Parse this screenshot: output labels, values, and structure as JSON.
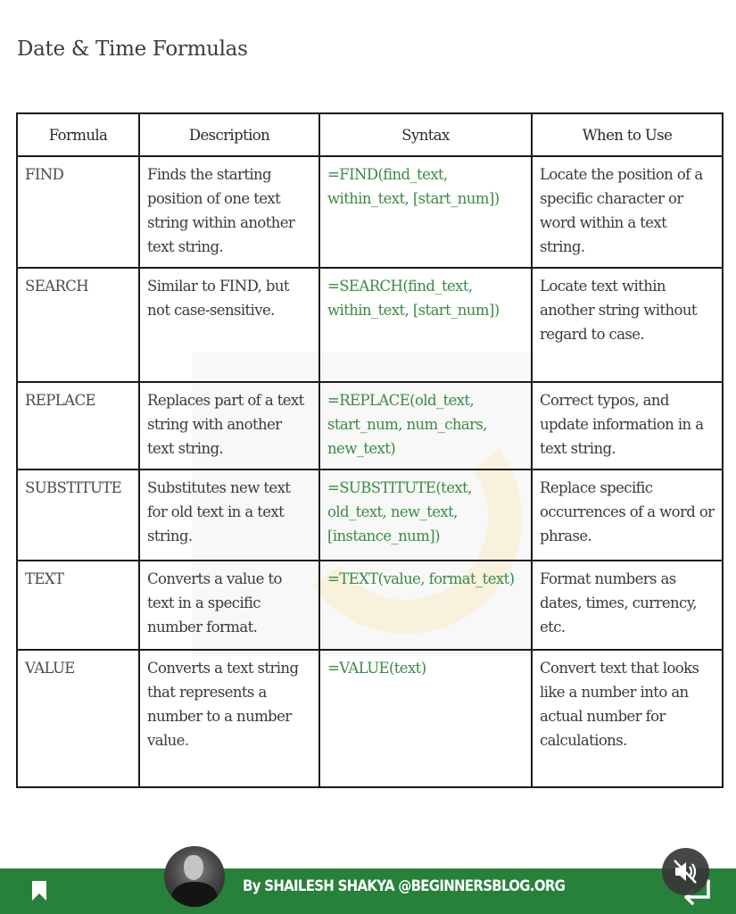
{
  "page": {
    "title": "Date & Time Formulas"
  },
  "table": {
    "headers": [
      "Formula",
      "Description",
      "Syntax",
      "When to Use"
    ],
    "rows": [
      {
        "formula": "FIND",
        "description": "Finds the starting position of one text string within another text string.",
        "syntax": "=FIND(find_text, within_text, [start_num])",
        "when": "Locate the position of a specific character or word within a text string."
      },
      {
        "formula": "SEARCH",
        "description": "Similar to FIND, but not case-sensitive.",
        "syntax": "=SEARCH(find_text, within_text, [start_num])",
        "when": "Locate text within another string without regard to case."
      },
      {
        "formula": "REPLACE",
        "description": "Replaces part of a text string with another text string.",
        "syntax": "=REPLACE(old_text, start_num, num_chars, new_text)",
        "when": "Correct typos, and update information in a text string."
      },
      {
        "formula": "SUBSTITUTE",
        "description": "Substitutes new text for old text in a text string.",
        "syntax": "=SUBSTITUTE(text, old_text, new_text, [instance_num])",
        "when": "Replace specific occurrences of a word or phrase."
      },
      {
        "formula": "TEXT",
        "description": "Converts a value to text in a specific number format.",
        "syntax": "=TEXT(value, format_text)",
        "when": "Format numbers as dates, times, currency, etc."
      },
      {
        "formula": "VALUE",
        "description": "Converts a text string that represents a number to a number value.",
        "syntax": "=VALUE(text)",
        "when": "Convert text that looks like a number into an actual number for calculations."
      }
    ]
  },
  "footer": {
    "byline": "By SHAILESH SHAKYA @BEGINNERSBLOG.ORG",
    "bookmark_icon": "bookmark-icon",
    "mute_icon": "speaker-muted-icon",
    "share_icon": "share-arrow-icon"
  },
  "colors": {
    "footer_bg": "#27813a",
    "syntax_text": "#3a8a45"
  }
}
